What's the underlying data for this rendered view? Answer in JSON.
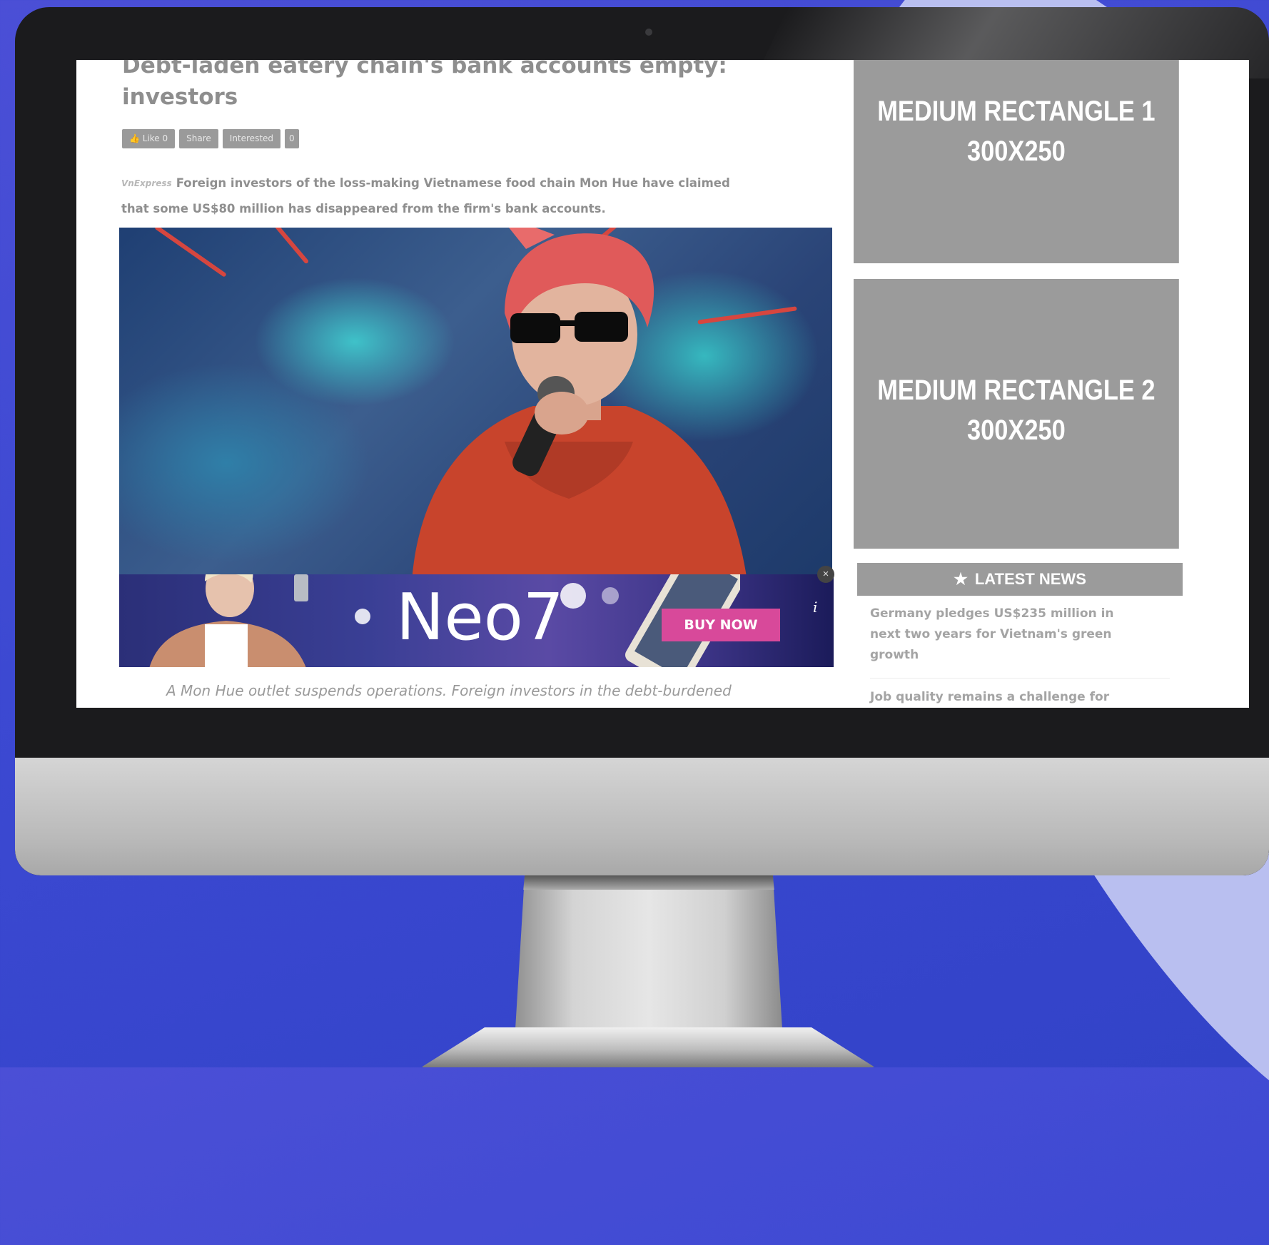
{
  "article": {
    "headline": "Debt-laden eatery chain's bank accounts empty: investors",
    "social": {
      "like": "Like 0",
      "share": "Share",
      "interested": "Interested",
      "interested_count": "0"
    },
    "source_logo": "VnExpress",
    "lead": "Foreign investors of the loss-making Vietnamese food chain Mon Hue have claimed that some US$80 million has disappeared from the firm's bank accounts.",
    "caption": "A Mon Hue outlet suspends operations. Foreign investors in the debt-burdened"
  },
  "banner_ad": {
    "product": "Neo7",
    "cta": "BUY NOW",
    "close": "×",
    "info": "i"
  },
  "sidebar": {
    "ad1": {
      "line1": "MEDIUM RECTANGLE 1",
      "line2": "300X250"
    },
    "ad2": {
      "line1": "MEDIUM RECTANGLE 2",
      "line2": "300X250"
    },
    "latest_news": {
      "title": "LATEST NEWS",
      "items": [
        "Germany pledges US$235 million in next two years for Vietnam's green growth",
        "Job quality remains a challenge for"
      ]
    }
  },
  "colors": {
    "background": "#3c49d2",
    "ad_placeholder": "#9b9b9b",
    "cta": "#d8499a"
  }
}
